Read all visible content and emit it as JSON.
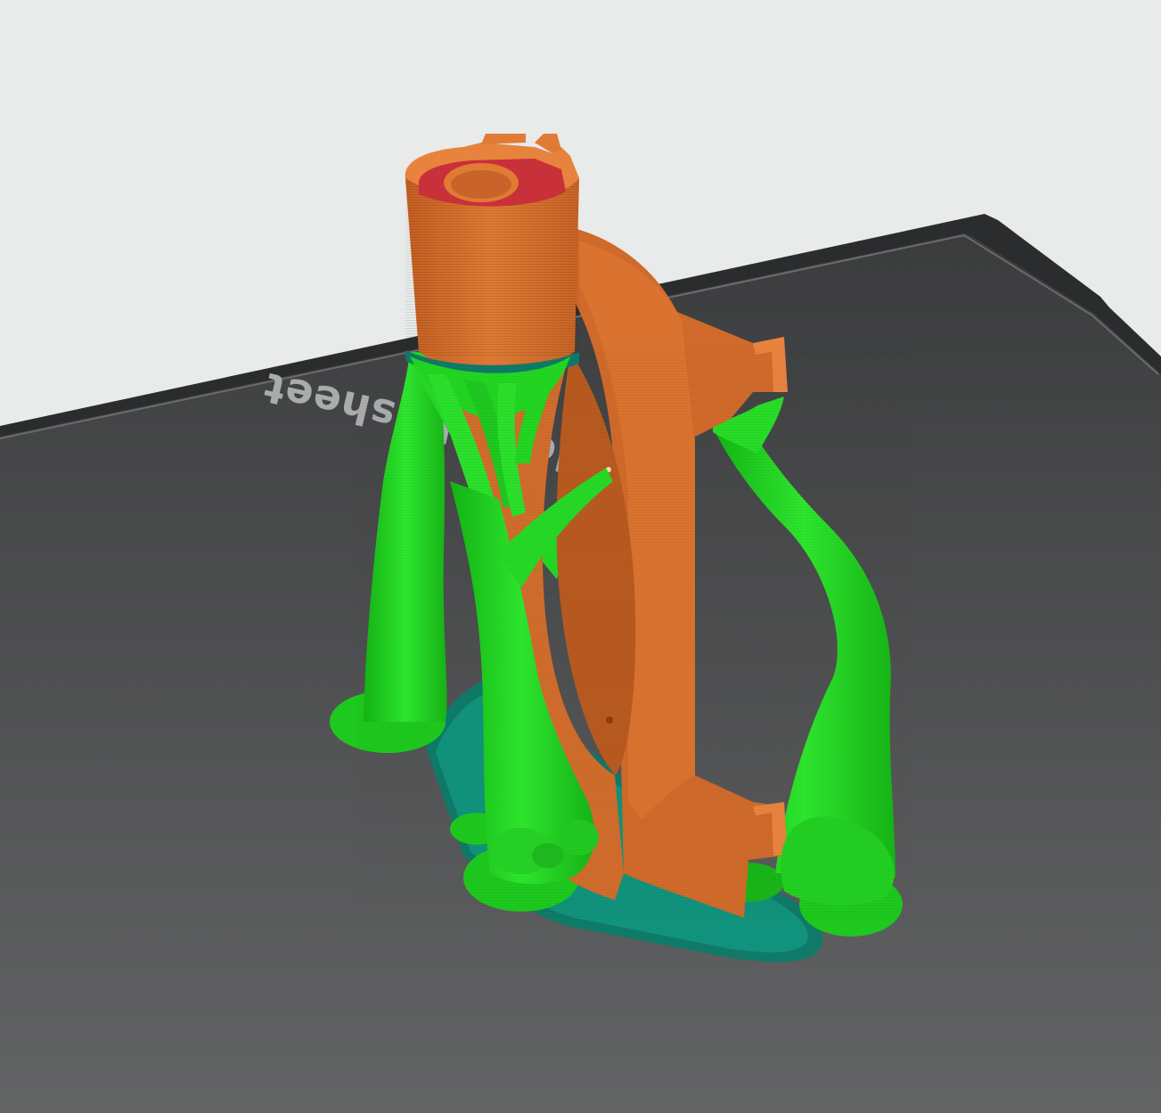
{
  "viewport": {
    "bed_label": "ided PEI sheet"
  },
  "colors": {
    "background": "#e9eaea",
    "bed_top": "#3f4041",
    "bed_bottom": "#5f6061",
    "bed_frame": "#2a2b2c",
    "perimeter": "#d4692a",
    "perimeter_light": "#f08a3e",
    "top_solid": "#c8303a",
    "support": "#1fd01f",
    "support_dark": "#14a014",
    "support_interface": "#0f7f6a"
  },
  "legend_features": [
    "perimeter",
    "top-solid-infill",
    "support-material",
    "support-interface"
  ]
}
